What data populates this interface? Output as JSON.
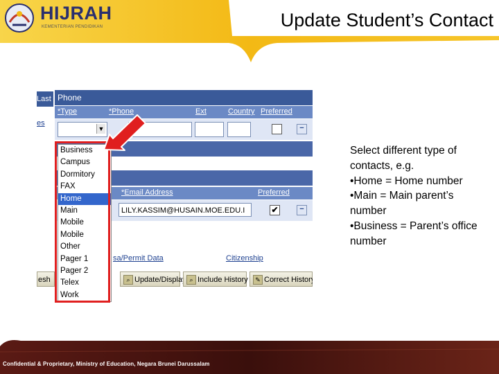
{
  "header": {
    "logo_text": "HIJRAH",
    "logo_subtext": "KEMENTERIAN PENDIDIKAN",
    "title": "Update Student’s Contact"
  },
  "phone_grid": {
    "left_tab_label": "Last",
    "left_link_fragment": "es",
    "title": "Phone",
    "columns": [
      "*Type",
      "*Phone",
      "Ext",
      "Country",
      "Preferred"
    ],
    "type_value": "",
    "phone_value": "",
    "ext_value": "",
    "country_value": "",
    "preferred_checked": false
  },
  "email_grid": {
    "columns": [
      "*Email Address",
      "Preferred"
    ],
    "email_value": "LILY.KASSIM@HUSAIN.MOE.EDU.I",
    "preferred_checked": true
  },
  "links": {
    "visa_permit": "sa/Permit Data",
    "citizenship": "Citizenship"
  },
  "toolbar": {
    "refresh_label": "esh",
    "update_display_label": "Update/Display",
    "include_history_label": "Include History",
    "correct_history_label": "Correct History"
  },
  "type_dropdown": {
    "options": [
      "Business",
      "Campus",
      "Dormitory",
      "FAX",
      "Home",
      "Main",
      "Mobile",
      "Mobile",
      "Other",
      "Pager 1",
      "Pager 2",
      "Telex",
      "Work"
    ],
    "selected": "Home"
  },
  "side_text": {
    "intro": "Select different type of contacts, e.g.",
    "items": [
      "•Home = Home number",
      "•Main = Main parent’s number",
      "•Business = Parent’s office number"
    ]
  },
  "footer": {
    "text": "Confidential & Proprietary, Ministry of Education, Negara Brunei Darussalam"
  },
  "colors": {
    "header_yellow": "#f6c21b",
    "grid_header_blue": "#3a5a99",
    "selection_blue": "#3366cc",
    "highlight_red": "#e01f1f",
    "footer_maroon": "#5a1a14"
  }
}
